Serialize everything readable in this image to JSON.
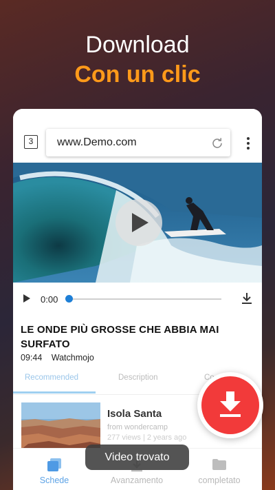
{
  "headline": {
    "line1": "Download",
    "line2": "Con un clic"
  },
  "browser": {
    "tab_count": "3",
    "url": "www.Demo.com"
  },
  "player": {
    "time": "0:00",
    "progress": 0
  },
  "video": {
    "title": "LE ONDE PIÙ GROSSE CHE ABBIA MAI SURFATO",
    "duration": "09:44",
    "channel": "Watchmojo"
  },
  "tabs": [
    {
      "label": "Recommended",
      "active": true
    },
    {
      "label": "Description",
      "active": false
    },
    {
      "label": "Co",
      "active": false
    }
  ],
  "recommended": {
    "title": "Isola Santa",
    "from": "from wondercamp",
    "views": "277 views | 2 years ago"
  },
  "nav": [
    {
      "label": "Schede",
      "icon": "tabs-icon",
      "active": true
    },
    {
      "label": "Avanzamento",
      "icon": "download-progress-icon",
      "active": false
    },
    {
      "label": "completato",
      "icon": "folder-icon",
      "active": false
    }
  ],
  "toast": "Video trovato",
  "colors": {
    "accent": "#ff9a1a",
    "primary_blue": "#1e7fd6",
    "download_red": "#f23a3a"
  }
}
